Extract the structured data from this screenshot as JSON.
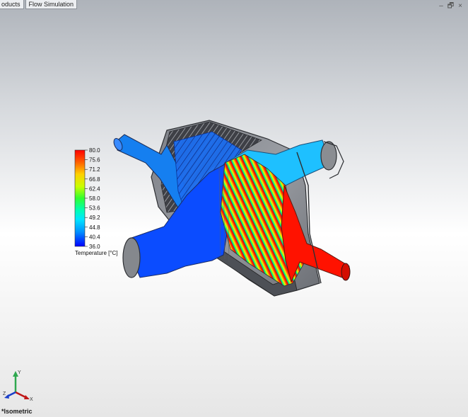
{
  "tabs": [
    {
      "label": "oducts"
    },
    {
      "label": "Flow Simulation"
    }
  ],
  "window_controls": {
    "minimize": "–",
    "restore": "🗗",
    "close": "×"
  },
  "legend": {
    "values": [
      "80.0",
      "75.6",
      "71.2",
      "66.8",
      "62.4",
      "58.0",
      "53.6",
      "49.2",
      "44.8",
      "40.4",
      "36.0"
    ],
    "title": "Temperature [°C]",
    "colors": [
      "#ff0000",
      "#ff6a00",
      "#ffd400",
      "#c8ff00",
      "#4cff00",
      "#00ff60",
      "#00ffd0",
      "#00c8ff",
      "#0064ff",
      "#0000ff"
    ]
  },
  "triad": {
    "x": "X",
    "y": "Y",
    "z": "Z"
  },
  "view": {
    "name": "*Isometric"
  },
  "colors": {
    "hot": "#ff1400",
    "cold": "#0a3cff",
    "warm_outlet": "#1ab4ff",
    "mid": "#00c8ff"
  }
}
